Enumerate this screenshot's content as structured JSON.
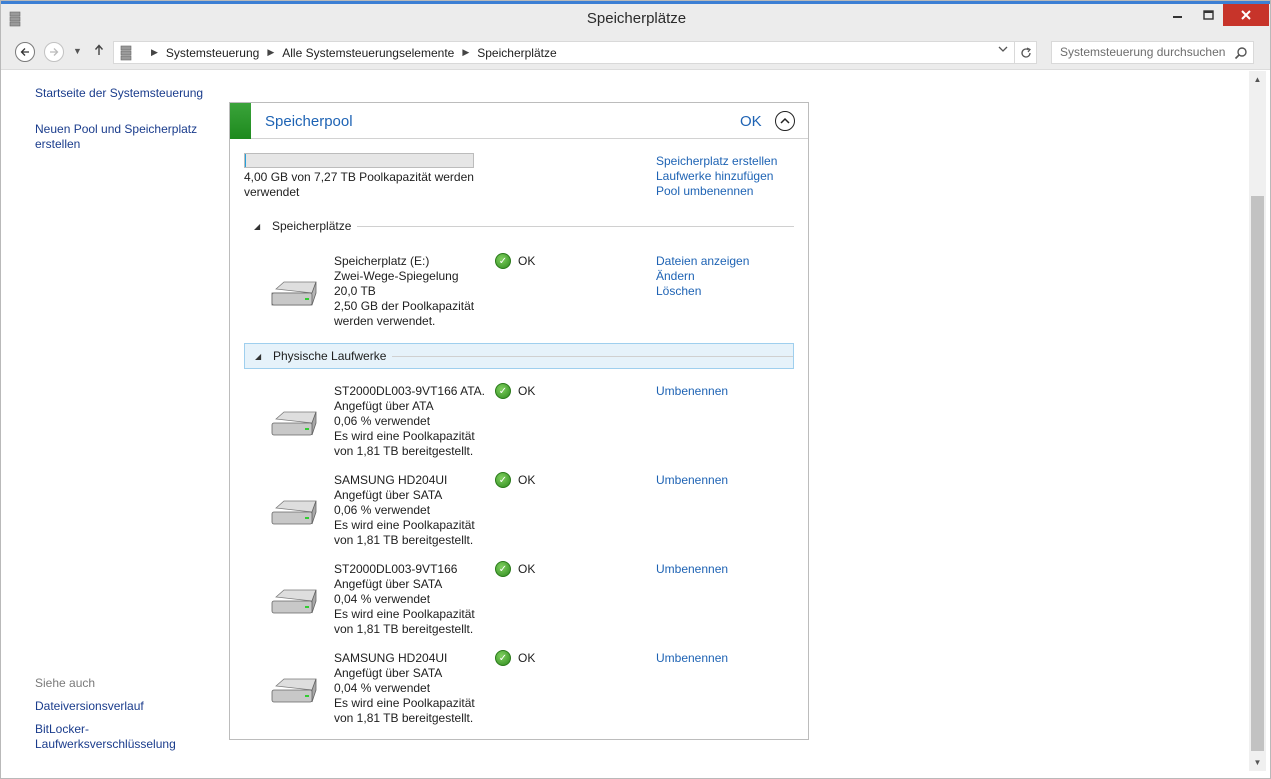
{
  "window": {
    "title": "Speicherplätze"
  },
  "nav": {
    "breadcrumb": [
      "Systemsteuerung",
      "Alle Systemsteuerungselemente",
      "Speicherplätze"
    ],
    "search_placeholder": "Systemsteuerung durchsuchen"
  },
  "sidebar": {
    "links": [
      "Startseite der Systemsteuerung",
      "Neuen Pool und Speicherplatz erstellen"
    ],
    "see_also_label": "Siehe auch",
    "see_also": [
      "Dateiversionsverlauf",
      "BitLocker-Laufwerksverschlüsselung"
    ]
  },
  "pool": {
    "title": "Speicherpool",
    "status": "OK",
    "capacity_used_fraction": 0.0005,
    "capacity_text": "4,00 GB von 7,27 TB Poolkapazität werden verwendet",
    "actions": [
      "Speicherplatz erstellen",
      "Laufwerke hinzufügen",
      "Pool umbenennen"
    ]
  },
  "spaces_section": {
    "label": "Speicherplätze",
    "items": [
      {
        "name": "Speicherplatz (E:)",
        "resiliency": "Zwei-Wege-Spiegelung",
        "size": "20,0 TB",
        "usage_line1": "2,50 GB der Poolkapazität",
        "usage_line2": "werden verwendet.",
        "status": "OK",
        "actions": [
          "Dateien anzeigen",
          "Ändern",
          "Löschen"
        ]
      }
    ]
  },
  "drives_section": {
    "label": "Physische Laufwerke",
    "items": [
      {
        "name": "ST2000DL003-9VT166 ATA...",
        "attached": "Angefügt über ATA",
        "used": "0,06 % verwendet",
        "pool_line1": "Es wird eine Poolkapazität",
        "pool_line2": "von 1,81 TB bereitgestellt.",
        "status": "OK",
        "action": "Umbenennen"
      },
      {
        "name": "SAMSUNG HD204UI",
        "attached": "Angefügt über SATA",
        "used": "0,06 % verwendet",
        "pool_line1": "Es wird eine Poolkapazität",
        "pool_line2": "von 1,81 TB bereitgestellt.",
        "status": "OK",
        "action": "Umbenennen"
      },
      {
        "name": "ST2000DL003-9VT166",
        "attached": "Angefügt über SATA",
        "used": "0,04 % verwendet",
        "pool_line1": "Es wird eine Poolkapazität",
        "pool_line2": "von 1,81 TB bereitgestellt.",
        "status": "OK",
        "action": "Umbenennen"
      },
      {
        "name": "SAMSUNG HD204UI",
        "attached": "Angefügt über SATA",
        "used": "0,04 % verwendet",
        "pool_line1": "Es wird eine Poolkapazität",
        "pool_line2": "von 1,81 TB bereitgestellt.",
        "status": "OK",
        "action": "Umbenennen"
      }
    ]
  },
  "colors": {
    "link": "#1e63b4",
    "pool_accent": "#2a982a",
    "status_ok": "#3a9a2a",
    "close_button": "#c7342a"
  }
}
